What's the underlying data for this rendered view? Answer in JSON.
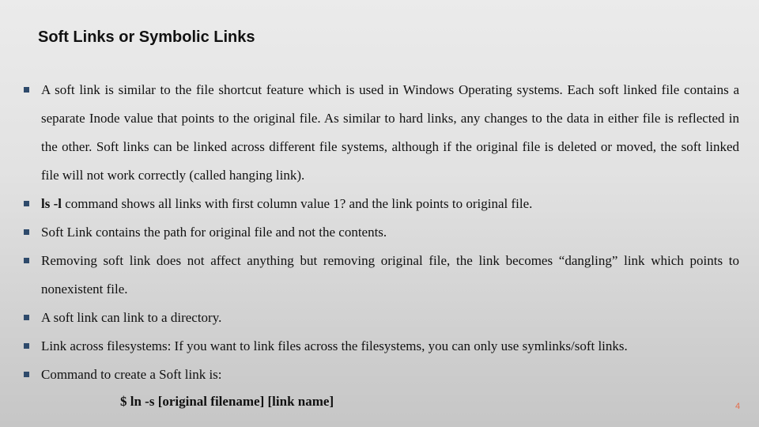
{
  "slide": {
    "title": "Soft Links or Symbolic Links",
    "bullets": [
      {
        "text": "A soft link is similar to the file shortcut feature which is used in Windows Operating systems. Each soft linked file contains a separate Inode value that points to the original file. As similar to hard links, any changes to the data in either file is reflected in the other. Soft links can be linked across different file systems, although if the original file is deleted or moved, the soft linked file will not work correctly (called hanging link)."
      },
      {
        "bold": "ls -l",
        "text": " command shows all links with first column value 1? and the link points to original file."
      },
      {
        "text": "Soft Link contains the path for original file and not the contents."
      },
      {
        "text": "Removing soft link does not affect anything but removing original file, the link becomes “dangling” link which points to nonexistent file."
      },
      {
        "text": "A soft link can link to a directory."
      },
      {
        "text": "Link across filesystems: If you want to link files across the filesystems, you can only use symlinks/soft links."
      },
      {
        "text": "Command to create a Soft link is:"
      }
    ],
    "command": "$ ln  -s [original filename] [link name]",
    "page_number": "4",
    "colors": {
      "bullet": "#2e4a6b",
      "page_number": "#e46c4a"
    }
  }
}
